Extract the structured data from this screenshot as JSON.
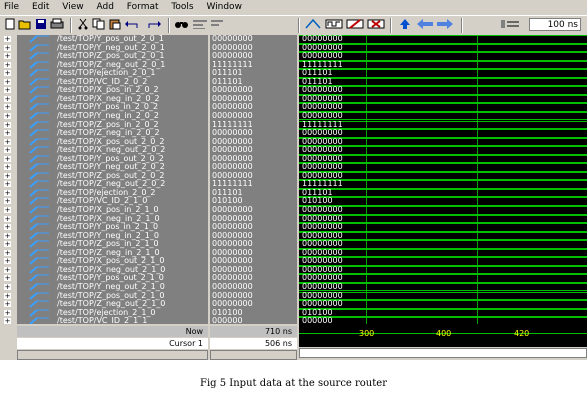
{
  "menu": [
    "File",
    "Edit",
    "View",
    "Add",
    "Format",
    "Tools",
    "Window"
  ],
  "toolbar": {
    "zoom_value": "100 ns"
  },
  "signals": [
    {
      "name": "/test/TOP/Y_pos_out_2_0_1",
      "value": "00000000"
    },
    {
      "name": "/test/TOP/Y_neg_out_2_0_1",
      "value": "00000000"
    },
    {
      "name": "/test/TOP/Z_pos_out_2_0_1",
      "value": "00000000"
    },
    {
      "name": "/test/TOP/Z_neg_out_2_0_1",
      "value": "11111111"
    },
    {
      "name": "/test/TOP/ejection_2_0_1",
      "value": "011101"
    },
    {
      "name": "/test/TOP/VC_ID_2_0_2",
      "value": "011101"
    },
    {
      "name": "/test/TOP/X_pos_in_2_0_2",
      "value": "00000000"
    },
    {
      "name": "/test/TOP/X_neg_in_2_0_2",
      "value": "00000000"
    },
    {
      "name": "/test/TOP/Y_pos_in_2_0_2",
      "value": "00000000"
    },
    {
      "name": "/test/TOP/Y_neg_in_2_0_2",
      "value": "00000000"
    },
    {
      "name": "/test/TOP/Z_pos_in_2_0_2",
      "value": "11111111"
    },
    {
      "name": "/test/TOP/Z_neg_in_2_0_2",
      "value": "00000000"
    },
    {
      "name": "/test/TOP/X_pos_out_2_0_2",
      "value": "00000000"
    },
    {
      "name": "/test/TOP/X_neg_out_2_0_2",
      "value": "00000000"
    },
    {
      "name": "/test/TOP/Y_pos_out_2_0_2",
      "value": "00000000"
    },
    {
      "name": "/test/TOP/Y_neg_out_2_0_2",
      "value": "00000000"
    },
    {
      "name": "/test/TOP/Z_pos_out_2_0_2",
      "value": "00000000"
    },
    {
      "name": "/test/TOP/Z_neg_out_2_0_2",
      "value": "11111111"
    },
    {
      "name": "/test/TOP/ejection_2_0_2",
      "value": "011101"
    },
    {
      "name": "/test/TOP/VC_ID_2_1_0",
      "value": "010100"
    },
    {
      "name": "/test/TOP/X_pos_in_2_1_0",
      "value": "00000000"
    },
    {
      "name": "/test/TOP/X_neg_in_2_1_0",
      "value": "00000000"
    },
    {
      "name": "/test/TOP/Y_pos_in_2_1_0",
      "value": "00000000"
    },
    {
      "name": "/test/TOP/Y_neg_in_2_1_0",
      "value": "00000000"
    },
    {
      "name": "/test/TOP/Z_pos_in_2_1_0",
      "value": "00000000"
    },
    {
      "name": "/test/TOP/Z_neg_in_2_1_0",
      "value": "00000000"
    },
    {
      "name": "/test/TOP/X_pos_out_2_1_0",
      "value": "00000000"
    },
    {
      "name": "/test/TOP/X_neg_out_2_1_0",
      "value": "00000000"
    },
    {
      "name": "/test/TOP/Y_pos_out_2_1_0",
      "value": "00000000"
    },
    {
      "name": "/test/TOP/Y_neg_out_2_1_0",
      "value": "00000000"
    },
    {
      "name": "/test/TOP/Z_pos_out_2_1_0",
      "value": "00000000"
    },
    {
      "name": "/test/TOP/Z_neg_out_2_1_0",
      "value": "00000000"
    },
    {
      "name": "/test/TOP/ejection_2_1_0",
      "value": "010100"
    },
    {
      "name": "/test/TOP/VC_ID_2_1_1",
      "value": "000000"
    },
    {
      "name": "/test/TOP/X_pos_in_2_1_1",
      "value": "00000000"
    }
  ],
  "status": {
    "now_label": "Now",
    "now_value": "710 ns",
    "cursor_label": "Cursor 1",
    "cursor_value": "506 ns"
  },
  "timeline": {
    "ticks": [
      "300",
      "400",
      "420"
    ]
  },
  "caption": "Fig 5 Input data at the source router",
  "colors": {
    "signal_bg": "#808080",
    "wave_bg": "#000000",
    "wave_green": "#00c000",
    "tick_yellow": "#ffff00"
  }
}
